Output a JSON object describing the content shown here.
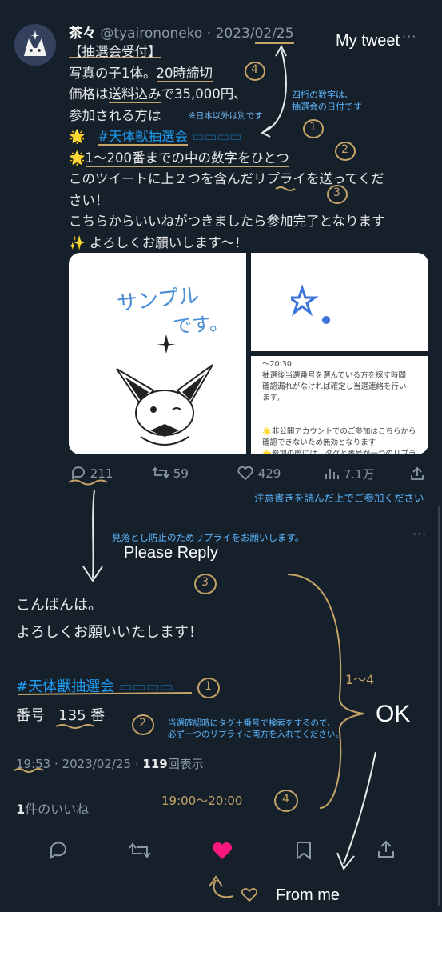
{
  "tweet": {
    "display_name": "茶々",
    "handle": "@tyairononeko",
    "separator": "·",
    "date_prefix": "2023/",
    "date_highlight": "02/25",
    "more": "···",
    "lines": {
      "l1": "【抽選会受付】",
      "l2a": "写真の子1体。",
      "l2b": "20時締切",
      "l3a": "価格は",
      "l3b": "送料込み",
      "l3c": "で35,000円、",
      "l4": "参加される方は",
      "l5_emoji": "🌟",
      "l5_hash": "#天体獣抽選会",
      "l6_emoji": "🌟",
      "l6": "1〜200番までの中の数字をひとつ",
      "l7": "このツイートに上２つを含んだリプライを送ってくだ",
      "l8": "さい！",
      "l9": "こちらからいいねがつきましたら参加完了となります",
      "l10_emoji": "✨",
      "l10": "よろしくお願いします〜！"
    },
    "media": {
      "sample_text_1": "サンプル",
      "sample_text_2": "です。",
      "panel3": [
        "〜20:30",
        "抽選後当選番号を選んでいる方を探す時間",
        "確認漏れがなければ確定し当選連絡を行い",
        "ます。",
        "",
        "🌟非公開アカウントでのご参加はこちらから",
        "確認できないため無効となります",
        "🌟参加の際には、タグと番号が一つのリプラ"
      ]
    },
    "stats": {
      "replies": "211",
      "retweets": "59",
      "likes": "429",
      "views": "7.1万"
    }
  },
  "annotations": {
    "my_tweet": "My tweet",
    "date_note_1": "四桁の数字は、",
    "date_note_2": "抽選会の日付です",
    "overseas_note": "※日本以外は別です",
    "caution": "注意書きを読んだ上でご参加ください",
    "reply_reason": "見落とし防止のためリプライをお願いします。",
    "please_reply": "Please Reply",
    "search_note_1": "当選確認時にタグ＋番号で検索をするので、",
    "search_note_2": "必ず一つのリプライに両方を入れてください。",
    "ok": "OK",
    "from_me": "From me",
    "num1": "1",
    "num2": "2",
    "num3": "3",
    "num4": "4",
    "range_label": "1〜4",
    "time_range": "19:00〜20:00"
  },
  "reply": {
    "line1": "こんばんは。",
    "line2": "よろしくお願いいたします！",
    "hashtag": "#天体獣抽選会",
    "number_label": "番号",
    "number_value": "135",
    "number_suffix": "番",
    "time": "19:53",
    "date": "2023/02/25",
    "views_count": "119",
    "views_label": "回表示",
    "likes_count": "1",
    "likes_label": "件のいいね"
  },
  "colors": {
    "background": "#15202b",
    "link": "#1d9bf0",
    "annotation_ink": "#c6a468",
    "annotation_blue": "#5cb7ff",
    "like_pink": "#f91880"
  }
}
